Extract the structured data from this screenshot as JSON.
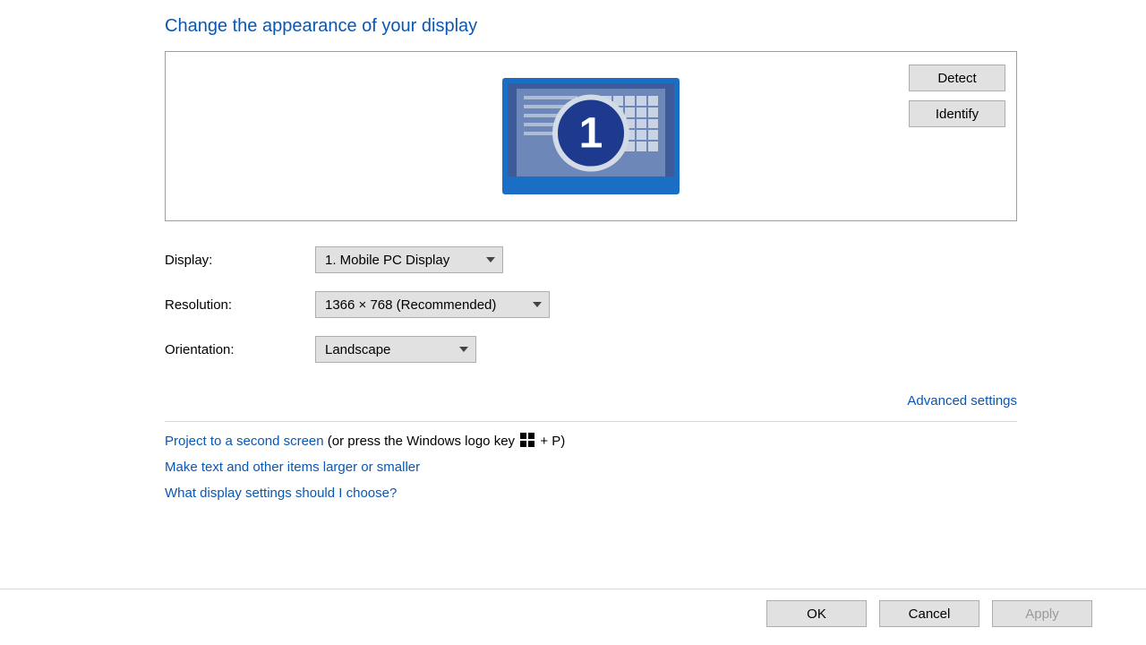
{
  "title": "Change the appearance of your display",
  "preview": {
    "detect_label": "Detect",
    "identify_label": "Identify",
    "monitor_number": "1"
  },
  "form": {
    "display_label": "Display:",
    "display_value": "1. Mobile PC Display",
    "resolution_label": "Resolution:",
    "resolution_value": "1366 × 768 (Recommended)",
    "orientation_label": "Orientation:",
    "orientation_value": "Landscape"
  },
  "advanced_link": "Advanced settings",
  "links": {
    "project_link": "Project to a second screen",
    "project_suffix_a": " (or press the Windows logo key ",
    "project_suffix_b": " + P)",
    "text_size_link": "Make text and other items larger or smaller",
    "help_link": "What display settings should I choose?"
  },
  "footer": {
    "ok": "OK",
    "cancel": "Cancel",
    "apply": "Apply"
  }
}
